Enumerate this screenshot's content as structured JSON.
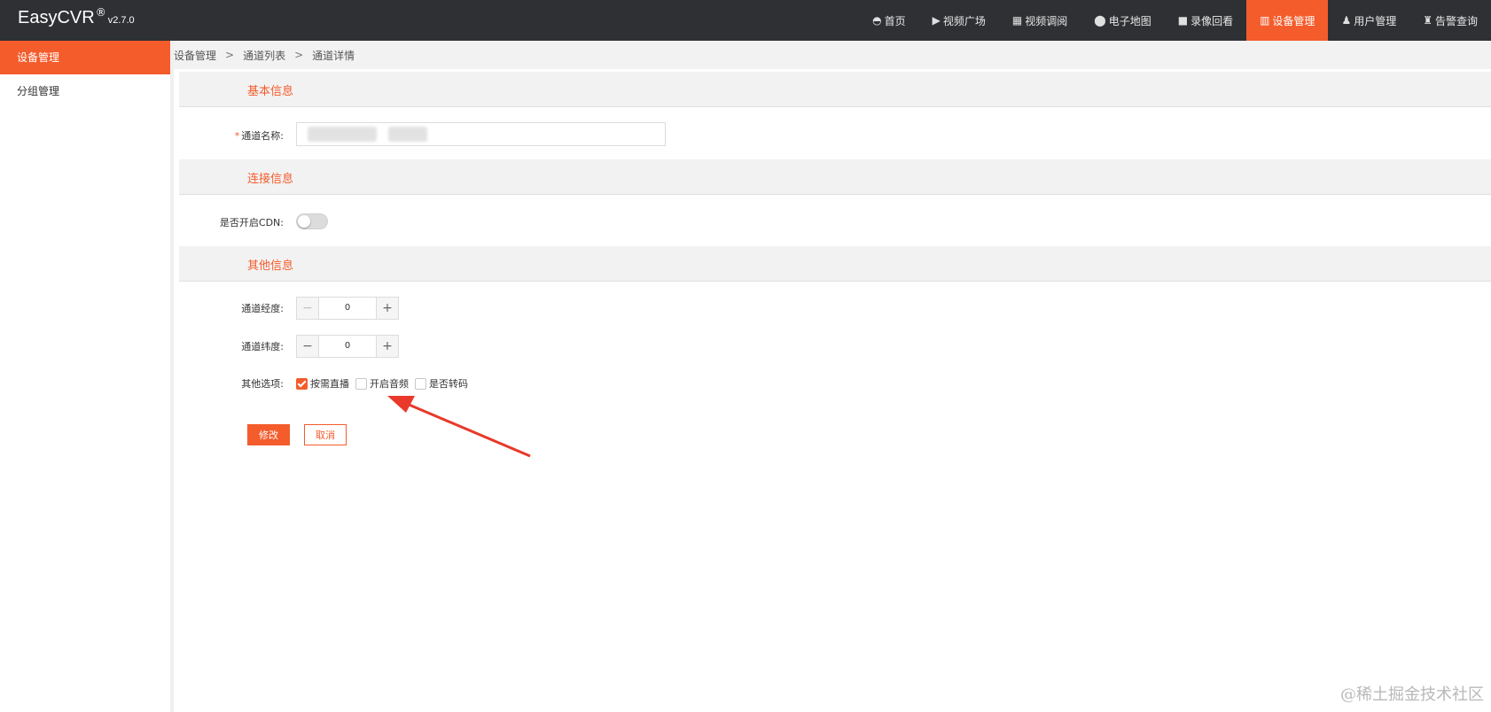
{
  "app": {
    "brand": "EasyCVR",
    "brand_mark": "®",
    "version": "v2.7.0"
  },
  "nav": [
    {
      "label": "首页",
      "icon": "dashboard-icon",
      "glyph": "◓"
    },
    {
      "label": "视频广场",
      "icon": "play-circle-icon",
      "glyph": "▶"
    },
    {
      "label": "视频调阅",
      "icon": "layout-icon",
      "glyph": "▦"
    },
    {
      "label": "电子地图",
      "icon": "map-pin-icon",
      "glyph": "⬤"
    },
    {
      "label": "录像回看",
      "icon": "video-camera-icon",
      "glyph": "■"
    },
    {
      "label": "设备管理",
      "icon": "device-columns-icon",
      "glyph": "▥",
      "active": true
    },
    {
      "label": "用户管理",
      "icon": "user-icon",
      "glyph": "♟"
    },
    {
      "label": "告警查询",
      "icon": "alarm-icon",
      "glyph": "♜"
    }
  ],
  "sidebar": {
    "items": [
      {
        "label": "设备管理",
        "active": true
      },
      {
        "label": "分组管理",
        "active": false
      }
    ]
  },
  "breadcrumb": [
    "设备管理",
    "通道列表",
    "通道详情"
  ],
  "breadcrumb_sep": ">",
  "sections": {
    "basic": "基本信息",
    "connection": "连接信息",
    "other": "其他信息"
  },
  "form": {
    "required_mark": "*",
    "channel_name_label": "通道名称:",
    "cdn_label": "是否开启CDN:",
    "cdn_enabled": false,
    "longitude_label": "通道经度:",
    "longitude_value": "0",
    "latitude_label": "通道纬度:",
    "latitude_value": "0",
    "minus": "−",
    "plus": "+",
    "options_label": "其他选项:",
    "options": [
      {
        "label": "按需直播",
        "checked": true
      },
      {
        "label": "开启音频",
        "checked": false
      },
      {
        "label": "是否转码",
        "checked": false
      }
    ],
    "submit_label": "修改",
    "cancel_label": "取消"
  },
  "watermark": "@稀土掘金技术社区",
  "colors": {
    "accent": "#f45c2c",
    "topbar": "#2e3033",
    "arrow": "#e8392a"
  }
}
